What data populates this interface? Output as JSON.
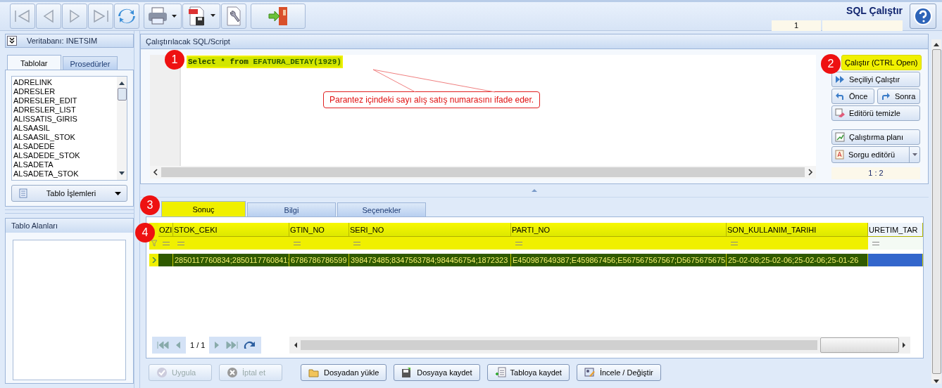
{
  "header": {
    "title": "SQL Çalıştır",
    "counter": "1"
  },
  "left_panel": {
    "database": "Veritabanı: INETSIM",
    "tabs": [
      {
        "label": "Tablolar",
        "selected": true
      },
      {
        "label": "Prosedürler",
        "selected": false
      }
    ],
    "tables": [
      "ADRELINK",
      "ADRESLER",
      "ADRESLER_EDIT",
      "ADRESLER_LIST",
      "ALISSATIS_GIRIS",
      "ALSAASIL",
      "ALSAASIL_STOK",
      "ALSADEDE",
      "ALSADEDE_STOK",
      "ALSADETA",
      "ALSADETA_STOK"
    ],
    "table_ops": "Tablo İşlemleri",
    "fields_title": "Tablo Alanları"
  },
  "editor": {
    "title": "Çalıştırılacak SQL/Script",
    "sql": "**Select * from** EFATURA_DETAY(1929)",
    "annotation": "Parantez içindeki sayı alış satış numarasını ifade eder.",
    "cursor": "1 : 2"
  },
  "actions": [
    {
      "kind": "single",
      "buttons": [
        {
          "label": "Çalıştır (CTRL Open)",
          "highlighted": true
        }
      ]
    },
    {
      "kind": "single",
      "buttons": [
        {
          "label": "Seçiliyi Çalıştır",
          "highlighted": false
        }
      ]
    },
    {
      "kind": "pair",
      "buttons": [
        {
          "label": "Önce",
          "highlighted": false
        },
        {
          "label": "Sonra",
          "highlighted": false
        }
      ]
    },
    {
      "kind": "single",
      "buttons": [
        {
          "label": "Editörü temizle",
          "highlighted": false
        }
      ]
    },
    {
      "kind": "single",
      "buttons": [
        {
          "label": "Çalıştırma planı",
          "highlighted": false
        }
      ]
    },
    {
      "kind": "dropdown",
      "buttons": [
        {
          "label": "Sorgu editörü",
          "highlighted": false
        }
      ]
    }
  ],
  "result_tabs": [
    {
      "label": "Sonuç",
      "selected": true
    },
    {
      "label": "Bilgi",
      "selected": false
    },
    {
      "label": "Seçenekler",
      "selected": false
    }
  ],
  "grid": {
    "columns": [
      {
        "label": "OZI",
        "highlighted": true
      },
      {
        "label": "STOK_CEKI",
        "highlighted": true
      },
      {
        "label": "GTIN_NO",
        "highlighted": true
      },
      {
        "label": "SERI_NO",
        "highlighted": true
      },
      {
        "label": "PARTI_NO",
        "highlighted": true
      },
      {
        "label": "SON_KULLANIM_TARIHI",
        "highlighted": true
      },
      {
        "label": "URETIM_TAR",
        "highlighted": false
      }
    ],
    "rows": [
      {
        "selected": true,
        "cells": [
          "",
          "2850117760834;2850117760841;",
          "6786786786599",
          "398473485;8347563784;984456754;1872323",
          "E450987649387;E459867456;E567567567567;D5675675675",
          "25-02-08;25-02-06;25-02-06;25-01-26",
          ""
        ]
      }
    ],
    "page": "1 / 1"
  },
  "bottom_buttons": [
    {
      "label": "Uygula",
      "disabled": true
    },
    {
      "label": "İptal et",
      "disabled": true
    },
    {
      "label": "Dosyadan yükle",
      "disabled": false
    },
    {
      "label": "Dosyaya kaydet",
      "disabled": false
    },
    {
      "label": "Tabloya kaydet",
      "disabled": false
    },
    {
      "label": "İncele / Değiştir",
      "disabled": false
    }
  ],
  "callouts": [
    "1",
    "2",
    "3",
    "4"
  ]
}
